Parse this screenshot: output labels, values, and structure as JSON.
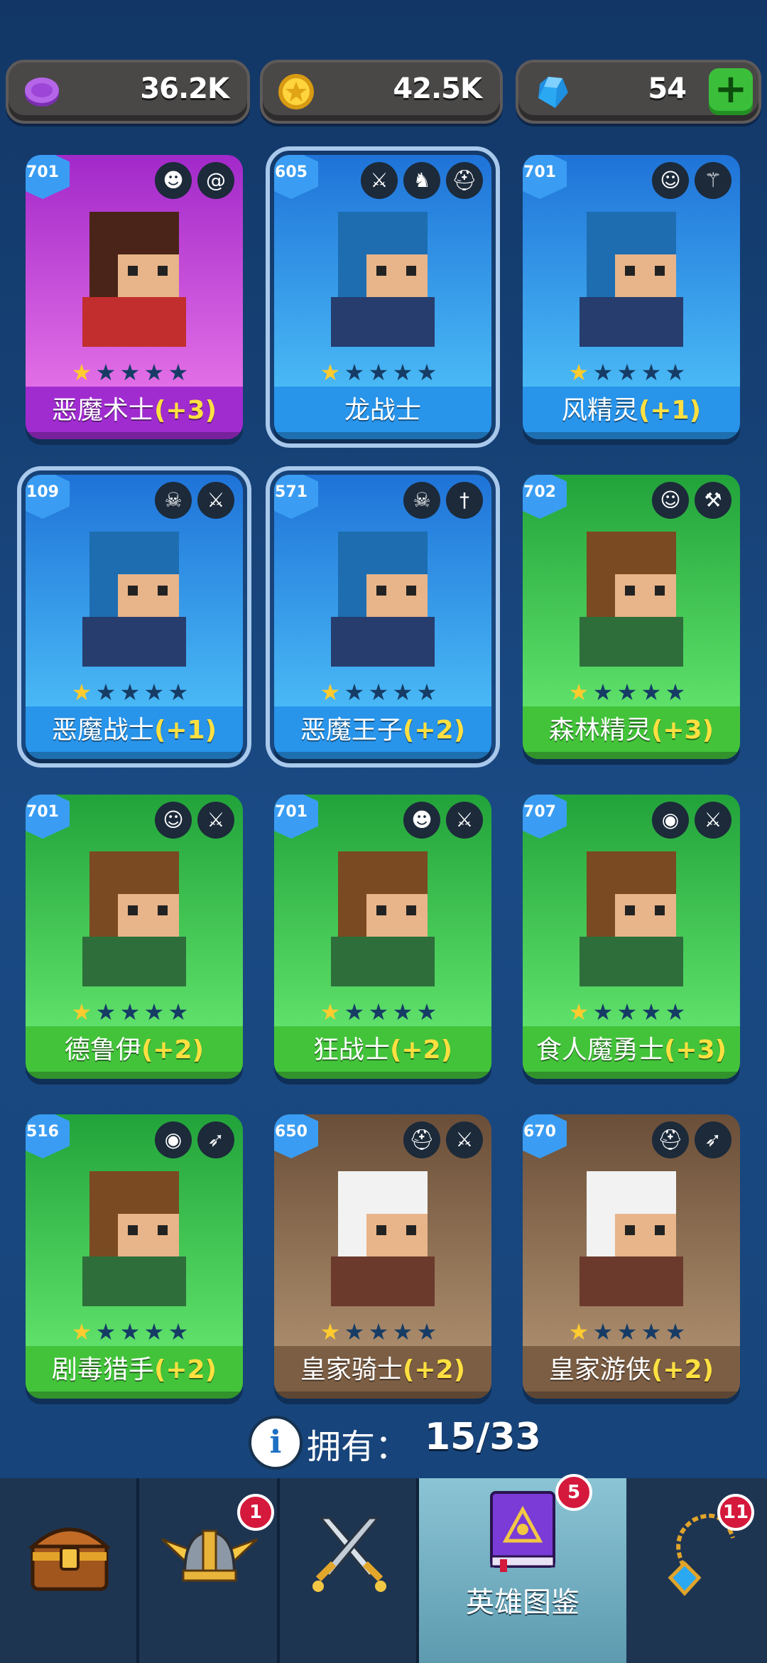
{
  "resources": [
    {
      "icon": "purple-token-icon",
      "value": "36.2K"
    },
    {
      "icon": "gold-coin-icon",
      "value": "42.5K"
    },
    {
      "icon": "blue-gem-icon",
      "value": "54",
      "plus": "+"
    }
  ],
  "cards": [
    {
      "level": "701",
      "name": "恶魔术士",
      "bonus": "(+3)",
      "rarity": "epic",
      "icons": [
        "orc-face-icon",
        "swirl-magic-icon"
      ],
      "stars": 1
    },
    {
      "level": "605",
      "name": "龙战士",
      "bonus": "",
      "rarity": "rare",
      "icons": [
        "sword-icon",
        "dragon-icon",
        "helmet-icon"
      ],
      "stars": 1,
      "selected": true
    },
    {
      "level": "701",
      "name": "风精灵",
      "bonus": "(+1)",
      "rarity": "rare",
      "icons": [
        "elf-face-icon",
        "staff-icon"
      ],
      "stars": 1
    },
    {
      "level": "109",
      "name": "恶魔战士",
      "bonus": "(+1)",
      "rarity": "rare",
      "icons": [
        "demon-skull-icon",
        "sword-icon"
      ],
      "stars": 1,
      "selected": true
    },
    {
      "level": "571",
      "name": "恶魔王子",
      "bonus": "(+2)",
      "rarity": "rare",
      "icons": [
        "demon-skull-icon",
        "dagger-icon"
      ],
      "stars": 1,
      "selected": true
    },
    {
      "level": "702",
      "name": "森林精灵",
      "bonus": "(+3)",
      "rarity": "uncommon",
      "icons": [
        "elf-face-icon",
        "hammer-icon"
      ],
      "stars": 1
    },
    {
      "level": "701",
      "name": "德鲁伊",
      "bonus": "(+2)",
      "rarity": "uncommon",
      "icons": [
        "elf-face-icon",
        "sword-icon"
      ],
      "stars": 1
    },
    {
      "level": "701",
      "name": "狂战士",
      "bonus": "(+2)",
      "rarity": "uncommon",
      "icons": [
        "orc-face-icon",
        "sword-icon"
      ],
      "stars": 1
    },
    {
      "level": "707",
      "name": "食人魔勇士",
      "bonus": "(+3)",
      "rarity": "uncommon",
      "icons": [
        "cyclops-face-icon",
        "sword-icon"
      ],
      "stars": 1
    },
    {
      "level": "516",
      "name": "剧毒猎手",
      "bonus": "(+2)",
      "rarity": "uncommon",
      "icons": [
        "cyclops-face-icon",
        "bow-icon"
      ],
      "stars": 1
    },
    {
      "level": "650",
      "name": "皇家骑士",
      "bonus": "(+2)",
      "rarity": "common",
      "icons": [
        "helmet-icon",
        "sword-icon"
      ],
      "stars": 1
    },
    {
      "level": "670",
      "name": "皇家游侠",
      "bonus": "(+2)",
      "rarity": "common",
      "icons": [
        "helmet-icon",
        "bow-icon"
      ],
      "stars": 1
    }
  ],
  "owned": {
    "label": "拥有：",
    "count": "15/33"
  },
  "nav": [
    {
      "icon": "treasure-chest-icon",
      "badge": ""
    },
    {
      "icon": "viking-helmet-icon",
      "badge": "1"
    },
    {
      "icon": "crossed-swords-icon",
      "badge": ""
    },
    {
      "icon": "hero-book-icon",
      "badge": "5",
      "label": "英雄图鉴",
      "active": true
    },
    {
      "icon": "amulet-icon",
      "badge": "11"
    }
  ],
  "colors": {
    "epic": "#c13de0",
    "rare": "#2f8fe8",
    "uncommon": "#3cc84a",
    "common": "#8a6b50",
    "bonus": "#ffe040",
    "star": "#ffcb2e"
  }
}
